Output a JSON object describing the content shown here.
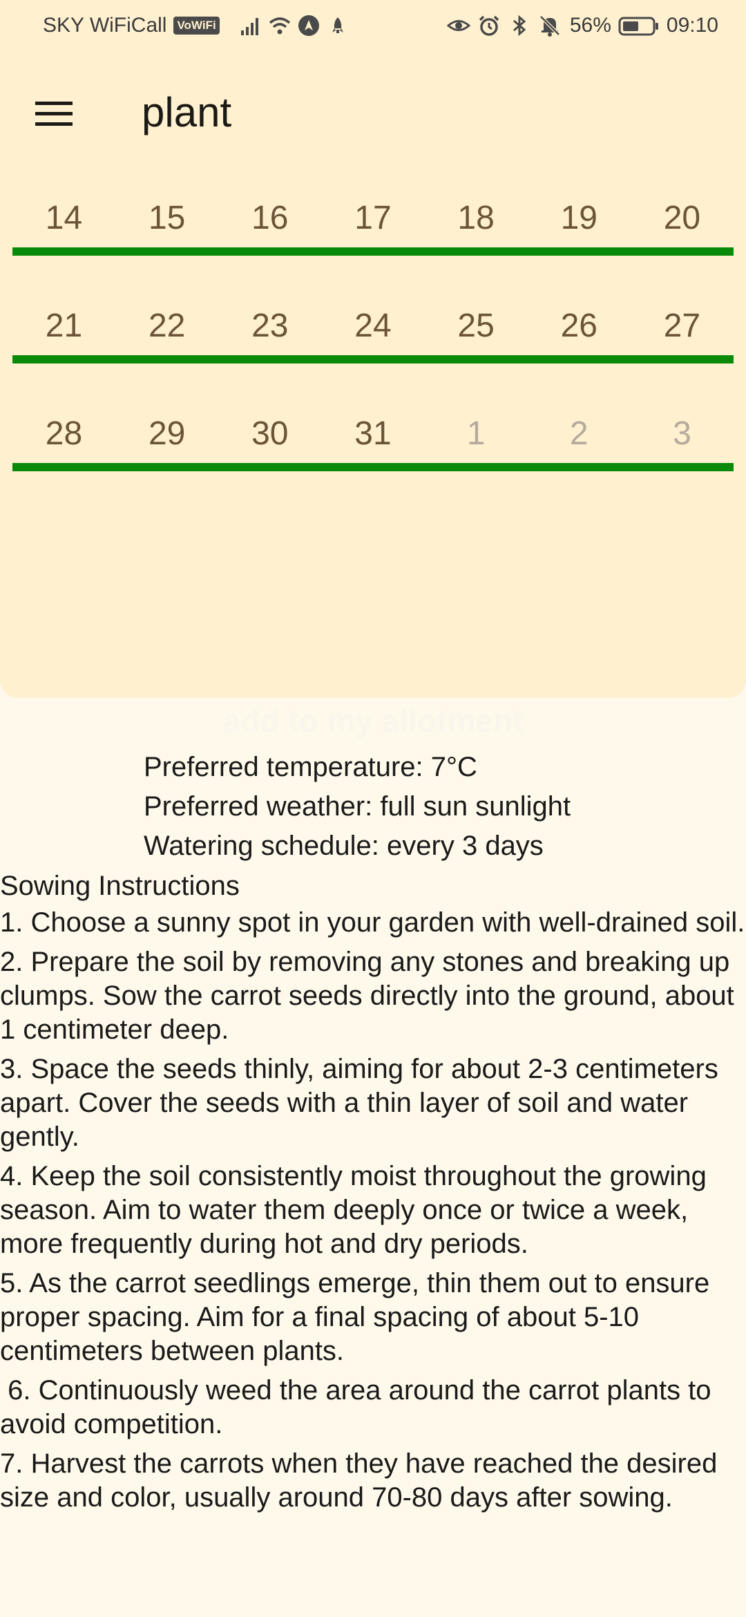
{
  "status_bar": {
    "carrier": "SKY WiFiCall",
    "vowifi": "VoWiFi",
    "battery": "56%",
    "time": "09:10"
  },
  "app_bar": {
    "title": "plant"
  },
  "calendar": {
    "weeks": [
      [
        "14",
        "15",
        "16",
        "17",
        "18",
        "19",
        "20"
      ],
      [
        "21",
        "22",
        "23",
        "24",
        "25",
        "26",
        "27"
      ],
      [
        "28",
        "29",
        "30",
        "31",
        "1",
        "2",
        "3"
      ]
    ]
  },
  "add_button": "add to my allotment",
  "info": {
    "temperature": "Preferred temperature: 7°C",
    "weather": "Preferred weather: full sun sunlight",
    "watering": "Watering schedule: every 3 days"
  },
  "instructions": {
    "heading": "Sowing Instructions",
    "steps": [
      "1. Choose a sunny spot in your garden with well-drained soil.",
      "2. Prepare the soil by removing any stones and breaking up clumps. Sow the carrot seeds directly into the ground, about 1 centimeter deep.",
      "3. Space the seeds thinly, aiming for about 2-3 centimeters apart. Cover the seeds with a thin layer of soil and water gently.",
      "4. Keep the soil consistently moist throughout the growing season. Aim to water them deeply once or twice a week, more frequently during hot and dry periods.",
      "5. As the carrot seedlings emerge, thin them out to ensure proper spacing. Aim for a final spacing of about 5-10 centimeters between plants.",
      " 6. Continuously weed the area around the carrot plants to avoid competition.",
      "7. Harvest the carrots when they have reached the desired size and color, usually around 70-80 days after sowing."
    ]
  }
}
